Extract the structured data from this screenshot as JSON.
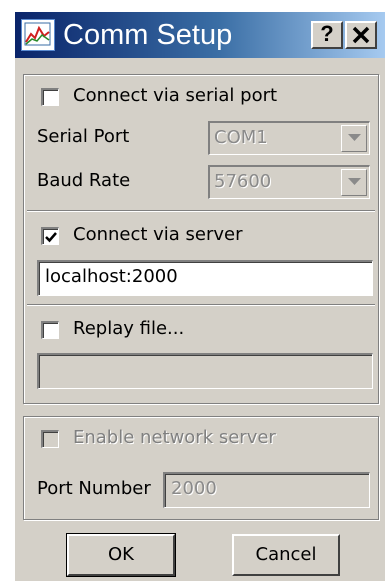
{
  "window": {
    "title": "Comm Setup",
    "help_label": "?",
    "close_label": "✕"
  },
  "serial": {
    "checkbox_label": "Connect via serial port",
    "checked": false,
    "port_label": "Serial Port",
    "port_value": "COM1",
    "baud_label": "Baud Rate",
    "baud_value": "57600"
  },
  "server": {
    "checkbox_label": "Connect via server",
    "checked": true,
    "address_value": "localhost:2000"
  },
  "replay": {
    "checkbox_label": "Replay file...",
    "checked": false,
    "file_value": ""
  },
  "network": {
    "checkbox_label": "Enable network server",
    "checked": false,
    "port_label": "Port Number",
    "port_value": "2000"
  },
  "buttons": {
    "ok_label": "OK",
    "cancel_label": "Cancel"
  },
  "icons": {
    "app": "chart-app-icon",
    "dropdown": "chevron-down-icon",
    "check": "checkmark-icon"
  }
}
